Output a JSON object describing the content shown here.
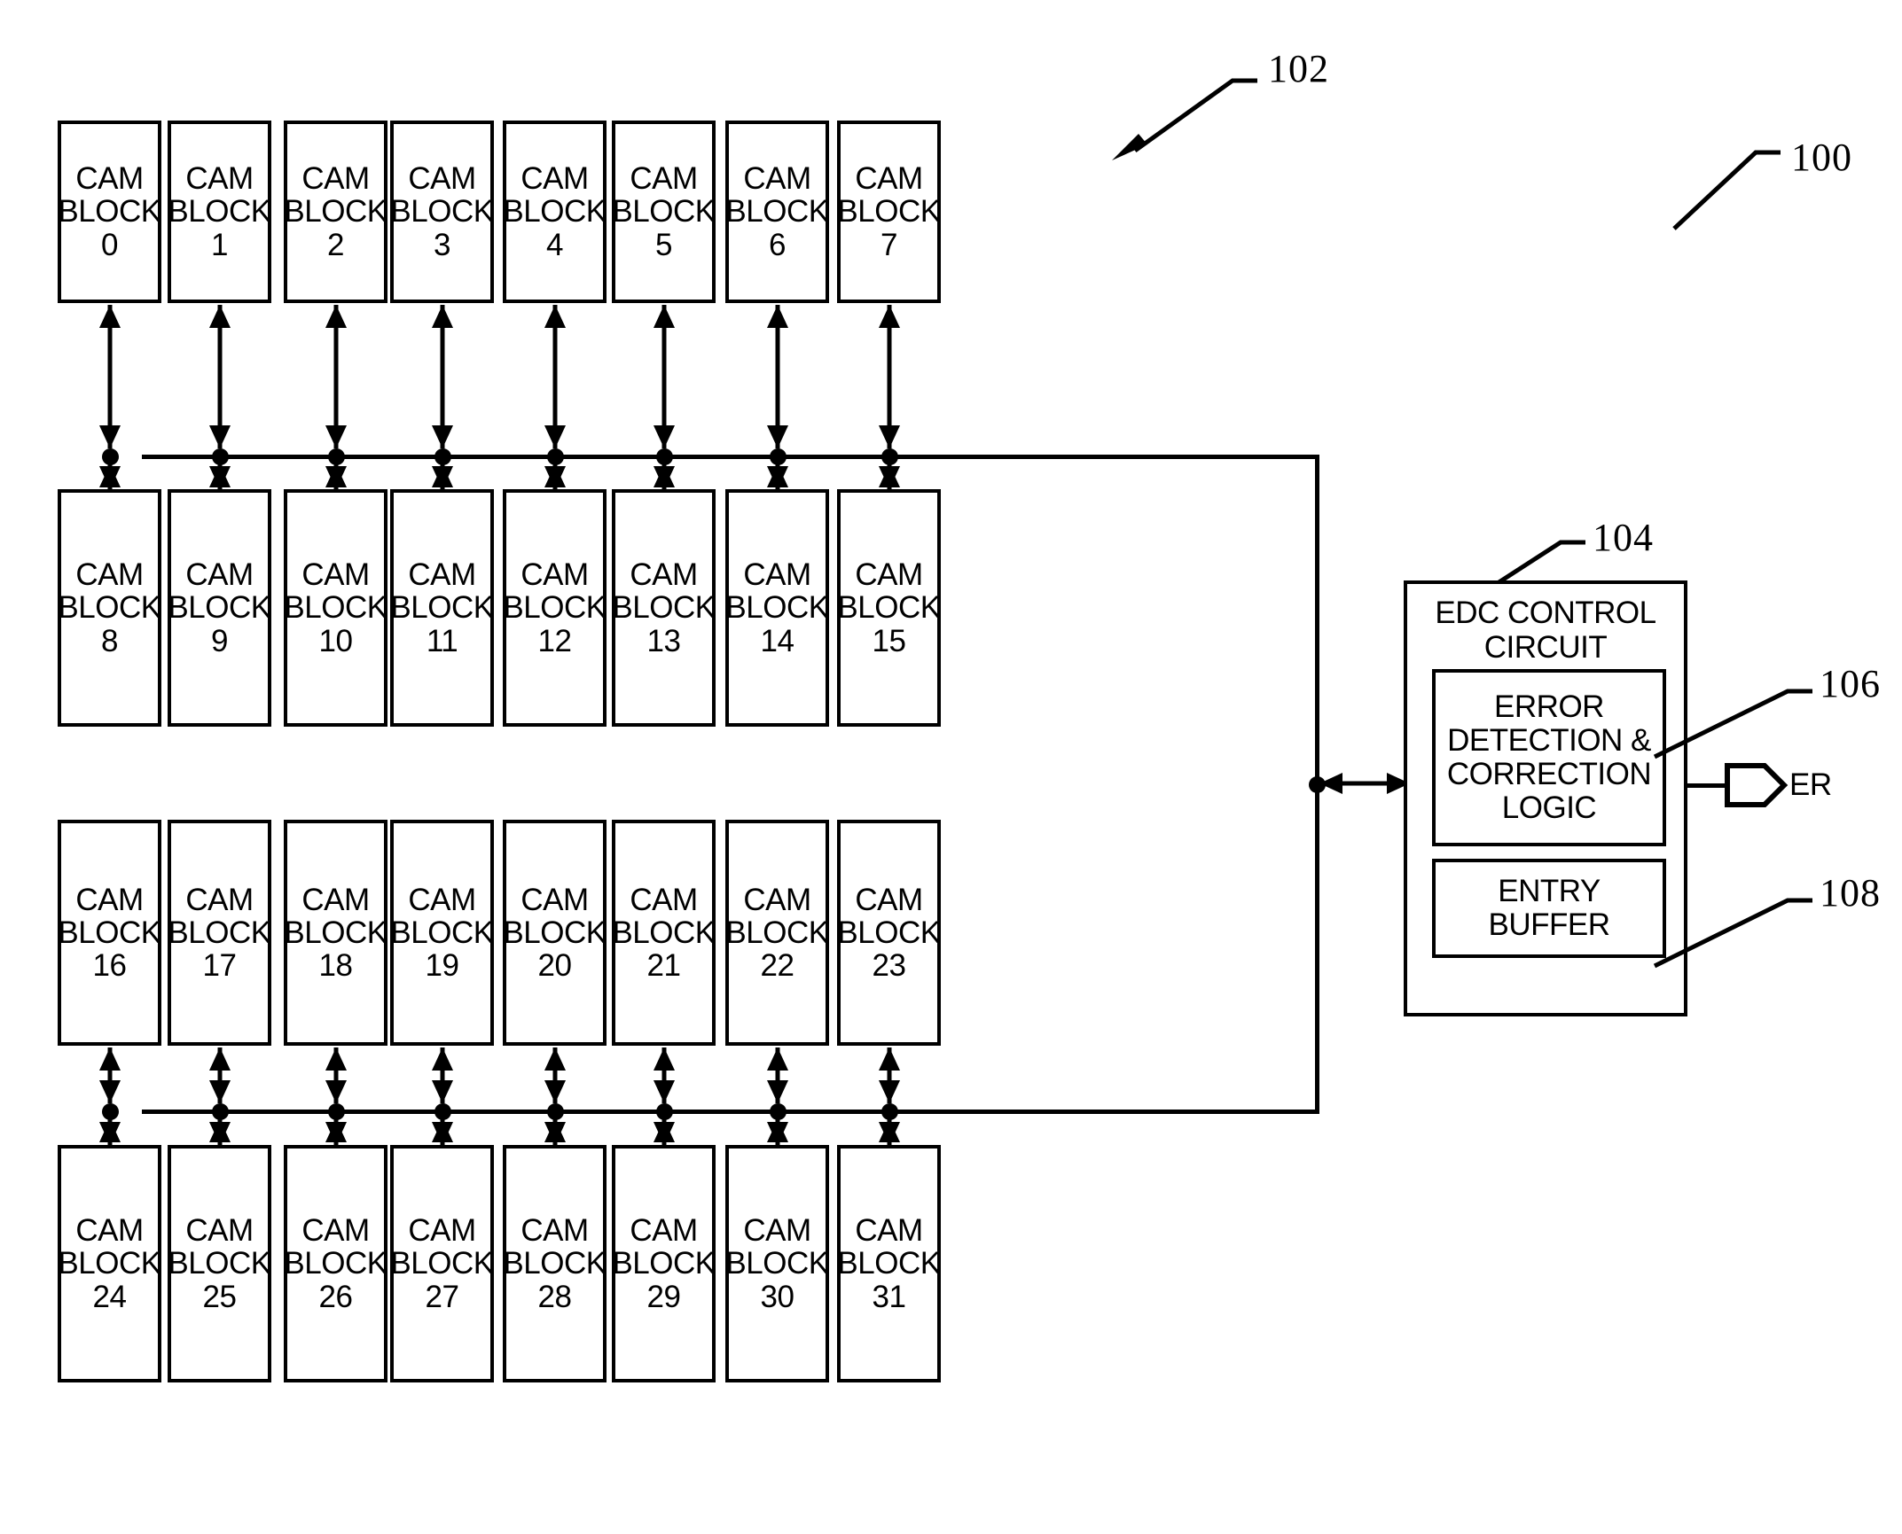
{
  "figure": {
    "title_ref": "100",
    "array_ref": "102",
    "cam_array": {
      "block_prefix_line1": "CAM",
      "block_prefix_line2": "BLOCK",
      "blocks": [
        {
          "id": 0,
          "number": "0"
        },
        {
          "id": 1,
          "number": "1"
        },
        {
          "id": 2,
          "number": "2"
        },
        {
          "id": 3,
          "number": "3"
        },
        {
          "id": 4,
          "number": "4"
        },
        {
          "id": 5,
          "number": "5"
        },
        {
          "id": 6,
          "number": "6"
        },
        {
          "id": 7,
          "number": "7"
        },
        {
          "id": 8,
          "number": "8"
        },
        {
          "id": 9,
          "number": "9"
        },
        {
          "id": 10,
          "number": "10"
        },
        {
          "id": 11,
          "number": "11"
        },
        {
          "id": 12,
          "number": "12"
        },
        {
          "id": 13,
          "number": "13"
        },
        {
          "id": 14,
          "number": "14"
        },
        {
          "id": 15,
          "number": "15"
        },
        {
          "id": 16,
          "number": "16"
        },
        {
          "id": 17,
          "number": "17"
        },
        {
          "id": 18,
          "number": "18"
        },
        {
          "id": 19,
          "number": "19"
        },
        {
          "id": 20,
          "number": "20"
        },
        {
          "id": 21,
          "number": "21"
        },
        {
          "id": 22,
          "number": "22"
        },
        {
          "id": 23,
          "number": "23"
        },
        {
          "id": 24,
          "number": "24"
        },
        {
          "id": 25,
          "number": "25"
        },
        {
          "id": 26,
          "number": "26"
        },
        {
          "id": 27,
          "number": "27"
        },
        {
          "id": 28,
          "number": "28"
        },
        {
          "id": 29,
          "number": "29"
        },
        {
          "id": 30,
          "number": "30"
        },
        {
          "id": 31,
          "number": "31"
        }
      ]
    },
    "edc": {
      "ref": "104",
      "title_line1": "EDC CONTROL",
      "title_line2": "CIRCUIT",
      "logic": {
        "ref": "106",
        "line1": "ERROR",
        "line2": "DETECTION &",
        "line3": "CORRECTION",
        "line4": "LOGIC"
      },
      "buffer": {
        "ref": "108",
        "line1": "ENTRY",
        "line2": "BUFFER"
      },
      "output_pin_label": "ER"
    },
    "colors": {
      "ink": "#000000",
      "paper": "#ffffff"
    }
  }
}
